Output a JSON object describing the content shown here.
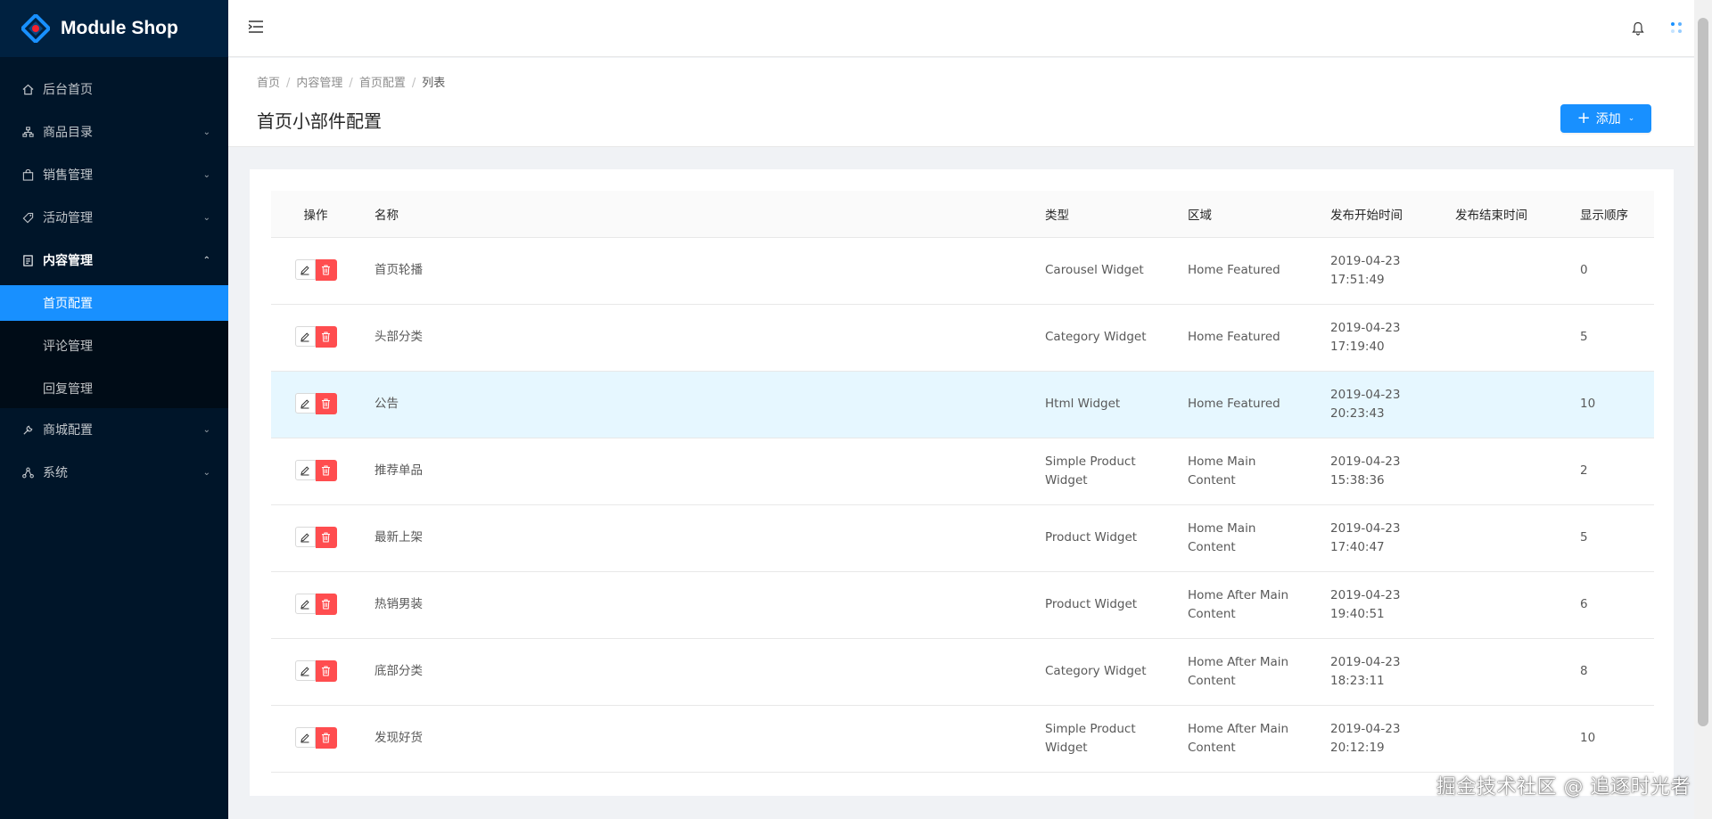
{
  "app": {
    "title": "Module Shop"
  },
  "sidebar": {
    "items": [
      {
        "label": "后台首页",
        "icon": "home-icon"
      },
      {
        "label": "商品目录",
        "icon": "cluster-icon"
      },
      {
        "label": "销售管理",
        "icon": "shopping-bag-icon"
      },
      {
        "label": "活动管理",
        "icon": "tag-icon"
      },
      {
        "label": "内容管理",
        "icon": "file-text-icon"
      },
      {
        "label": "商城配置",
        "icon": "tool-icon"
      },
      {
        "label": "系统",
        "icon": "apartment-icon"
      }
    ],
    "sub_items": [
      "首页配置",
      "评论管理",
      "回复管理"
    ]
  },
  "breadcrumb": [
    "首页",
    "内容管理",
    "首页配置",
    "列表"
  ],
  "page": {
    "title": "首页小部件配置",
    "add_label": "添加"
  },
  "table": {
    "headers": [
      "操作",
      "名称",
      "类型",
      "区域",
      "发布开始时间",
      "发布结束时间",
      "显示顺序"
    ],
    "rows": [
      {
        "name": "首页轮播",
        "type": [
          "Carousel Widget"
        ],
        "area": [
          "Home Featured"
        ],
        "start": [
          "2019-04-23",
          "17:51:49"
        ],
        "end": "",
        "order": "0"
      },
      {
        "name": "头部分类",
        "type": [
          "Category Widget"
        ],
        "area": [
          "Home Featured"
        ],
        "start": [
          "2019-04-23",
          "17:19:40"
        ],
        "end": "",
        "order": "5"
      },
      {
        "name": "公告",
        "type": [
          "Html Widget"
        ],
        "area": [
          "Home Featured"
        ],
        "start": [
          "2019-04-23",
          "20:23:43"
        ],
        "end": "",
        "order": "10"
      },
      {
        "name": "推荐单品",
        "type": [
          "Simple Product",
          "Widget"
        ],
        "area": [
          "Home Main Content"
        ],
        "start": [
          "2019-04-23",
          "15:38:36"
        ],
        "end": "",
        "order": "2"
      },
      {
        "name": "最新上架",
        "type": [
          "Product Widget"
        ],
        "area": [
          "Home Main Content"
        ],
        "start": [
          "2019-04-23",
          "17:40:47"
        ],
        "end": "",
        "order": "5"
      },
      {
        "name": "热销男装",
        "type": [
          "Product Widget"
        ],
        "area": [
          "Home After Main",
          "Content"
        ],
        "start": [
          "2019-04-23",
          "19:40:51"
        ],
        "end": "",
        "order": "6"
      },
      {
        "name": "底部分类",
        "type": [
          "Category Widget"
        ],
        "area": [
          "Home After Main",
          "Content"
        ],
        "start": [
          "2019-04-23",
          "18:23:11"
        ],
        "end": "",
        "order": "8"
      },
      {
        "name": "发现好货",
        "type": [
          "Simple Product",
          "Widget"
        ],
        "area": [
          "Home After Main",
          "Content"
        ],
        "start": [
          "2019-04-23",
          "20:12:19"
        ],
        "end": "",
        "order": "10"
      }
    ]
  },
  "watermark": "掘金技术社区 @ 追逐时光者",
  "colors": {
    "sidebar_bg": "#001529",
    "accent": "#1890ff",
    "danger": "#ff4d4f",
    "row_hover": "#e6f7ff"
  }
}
